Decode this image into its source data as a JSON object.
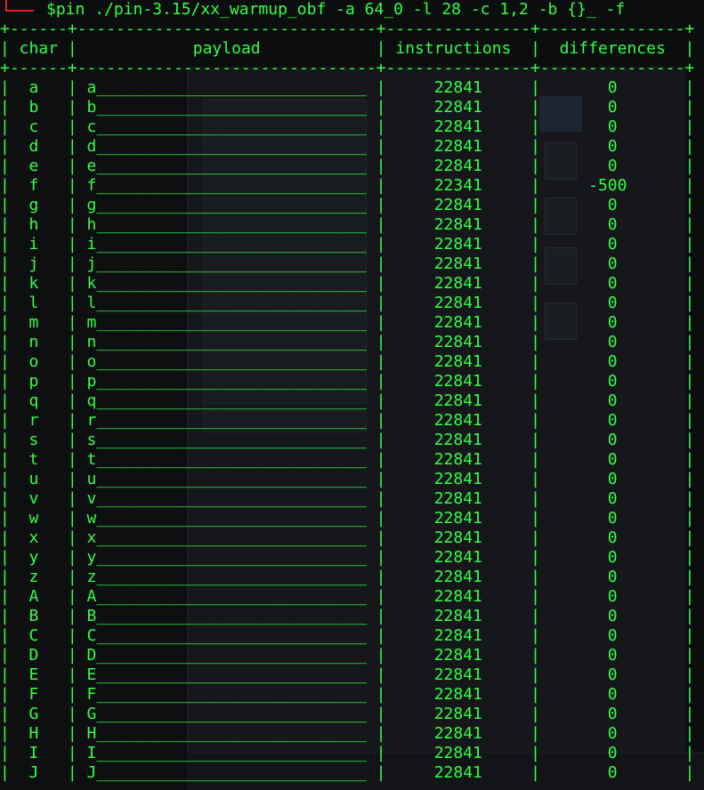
{
  "prompt": {
    "symbol": "$",
    "command": "pin ./pin-3.15/xx_warmup_obf -a 64_0 -l 28 -c 1,2 -b {}_ -f"
  },
  "table": {
    "separator": "+------+-------------------------------+---------------+---------------+",
    "headers": [
      "char",
      "payload",
      "instructions",
      "differences"
    ],
    "payload_padding": "_",
    "rows": [
      {
        "char": "a",
        "instructions": "22841",
        "difference": "0"
      },
      {
        "char": "b",
        "instructions": "22841",
        "difference": "0"
      },
      {
        "char": "c",
        "instructions": "22841",
        "difference": "0"
      },
      {
        "char": "d",
        "instructions": "22841",
        "difference": "0"
      },
      {
        "char": "e",
        "instructions": "22841",
        "difference": "0"
      },
      {
        "char": "f",
        "instructions": "22341",
        "difference": "-500"
      },
      {
        "char": "g",
        "instructions": "22841",
        "difference": "0"
      },
      {
        "char": "h",
        "instructions": "22841",
        "difference": "0"
      },
      {
        "char": "i",
        "instructions": "22841",
        "difference": "0"
      },
      {
        "char": "j",
        "instructions": "22841",
        "difference": "0"
      },
      {
        "char": "k",
        "instructions": "22841",
        "difference": "0"
      },
      {
        "char": "l",
        "instructions": "22841",
        "difference": "0"
      },
      {
        "char": "m",
        "instructions": "22841",
        "difference": "0"
      },
      {
        "char": "n",
        "instructions": "22841",
        "difference": "0"
      },
      {
        "char": "o",
        "instructions": "22841",
        "difference": "0"
      },
      {
        "char": "p",
        "instructions": "22841",
        "difference": "0"
      },
      {
        "char": "q",
        "instructions": "22841",
        "difference": "0"
      },
      {
        "char": "r",
        "instructions": "22841",
        "difference": "0"
      },
      {
        "char": "s",
        "instructions": "22841",
        "difference": "0"
      },
      {
        "char": "t",
        "instructions": "22841",
        "difference": "0"
      },
      {
        "char": "u",
        "instructions": "22841",
        "difference": "0"
      },
      {
        "char": "v",
        "instructions": "22841",
        "difference": "0"
      },
      {
        "char": "w",
        "instructions": "22841",
        "difference": "0"
      },
      {
        "char": "x",
        "instructions": "22841",
        "difference": "0"
      },
      {
        "char": "y",
        "instructions": "22841",
        "difference": "0"
      },
      {
        "char": "z",
        "instructions": "22841",
        "difference": "0"
      },
      {
        "char": "A",
        "instructions": "22841",
        "difference": "0"
      },
      {
        "char": "B",
        "instructions": "22841",
        "difference": "0"
      },
      {
        "char": "C",
        "instructions": "22841",
        "difference": "0"
      },
      {
        "char": "D",
        "instructions": "22841",
        "difference": "0"
      },
      {
        "char": "E",
        "instructions": "22841",
        "difference": "0"
      },
      {
        "char": "F",
        "instructions": "22841",
        "difference": "0"
      },
      {
        "char": "G",
        "instructions": "22841",
        "difference": "0"
      },
      {
        "char": "H",
        "instructions": "22841",
        "difference": "0"
      },
      {
        "char": "I",
        "instructions": "22841",
        "difference": "0"
      },
      {
        "char": "J",
        "instructions": "22841",
        "difference": "0"
      }
    ]
  },
  "colors": {
    "terminal_text": "#33ff44",
    "prompt_corner": "#e02020",
    "background": "#0c0d0f"
  }
}
